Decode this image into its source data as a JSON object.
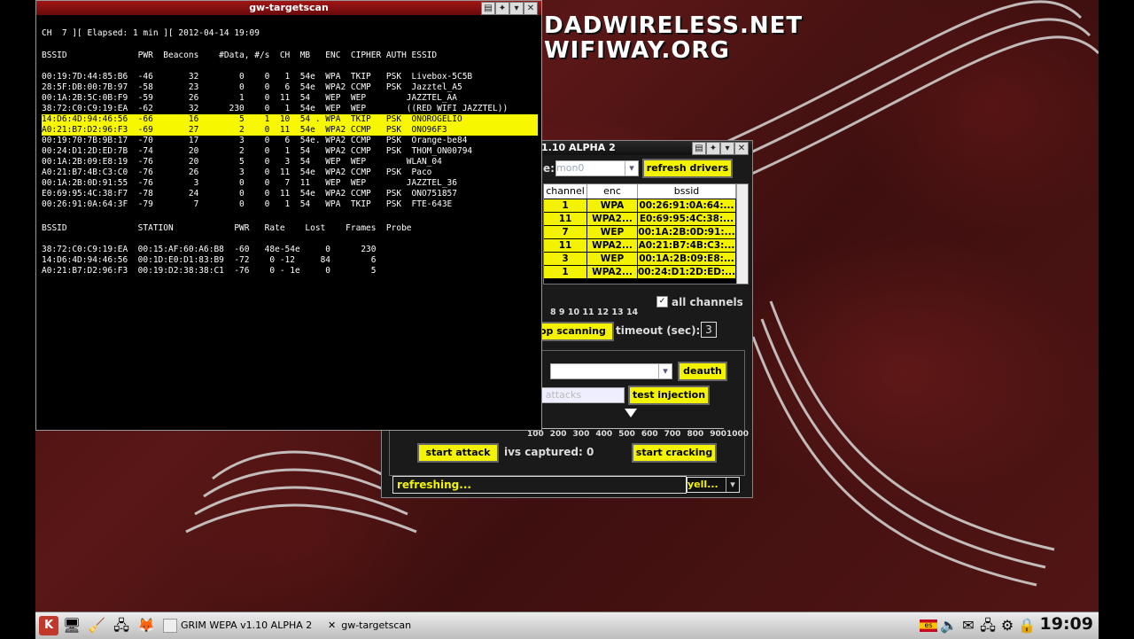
{
  "desktop": {
    "brand_line1": "DADWIRELESS.NET",
    "brand_line2": "WIFIWAY.ORG"
  },
  "terminal": {
    "title": "gw-targetscan",
    "status_line": "CH  7 ][ Elapsed: 1 min ][ 2012-04-14 19:09",
    "ap_header": "BSSID              PWR  Beacons    #Data, #/s  CH  MB   ENC  CIPHER AUTH ESSID",
    "ap_rows": [
      {
        "text": "00:19:7D:44:85:B6  -46       32        0    0   1  54e  WPA  TKIP   PSK  Livebox-5C5B",
        "hl": false
      },
      {
        "text": "28:5F:DB:00:7B:97  -58       23        0    0   6  54e  WPA2 CCMP   PSK  Jazztel_A5",
        "hl": false
      },
      {
        "text": "00:1A:2B:5C:0B:F9  -59       26        1    0  11  54   WEP  WEP        JAZZTEL_AA",
        "hl": false
      },
      {
        "text": "38:72:C0:C9:19:EA  -62       32      230    0   1  54e  WEP  WEP        ((RED WIFI JAZZTEL))",
        "hl": false
      },
      {
        "text": "14:D6:4D:94:46:56  -66       16        5    1  10  54 . WPA  TKIP   PSK  ONOROGELIO",
        "hl": true
      },
      {
        "text": "A0:21:B7:D2:96:F3  -69       27        2    0  11  54e  WPA2 CCMP   PSK  ONO96F3",
        "hl": true
      },
      {
        "text": "00:19:70:7B:9B:17  -70       17        3    0   6  54e. WPA2 CCMP   PSK  Orange-be84",
        "hl": false
      },
      {
        "text": "00:24:D1:2D:ED:7B  -74       20        2    0   1  54   WPA2 CCMP   PSK  THOM_ON00794",
        "hl": false
      },
      {
        "text": "00:1A:2B:09:E8:19  -76       20        5    0   3  54   WEP  WEP        WLAN_04",
        "hl": false
      },
      {
        "text": "A0:21:B7:4B:C3:C0  -76       26        3    0  11  54e  WPA2 CCMP   PSK  Paco",
        "hl": false
      },
      {
        "text": "00:1A:2B:0D:91:55  -76        3        0    0   7  11   WEP  WEP        JAZZTEL_36",
        "hl": false
      },
      {
        "text": "E0:69:95:4C:38:F7  -78       24        0    0  11  54e  WPA2 CCMP   PSK  ONO751857",
        "hl": false
      },
      {
        "text": "00:26:91:0A:64:3F  -79        7        0    0   1  54   WPA  TKIP   PSK  FTE-643E",
        "hl": false
      }
    ],
    "sta_header": "BSSID              STATION            PWR   Rate    Lost    Frames  Probe",
    "sta_rows": [
      "38:72:C0:C9:19:EA  00:15:AF:60:A6:B8  -60   48e-54e     0      230",
      "14:D6:4D:94:46:56  00:1D:E0:D1:83:B9  -72    0 -12     84        6",
      "A0:21:B7:D2:96:F3  00:19:D2:38:38:C1  -76    0 - 1e     0        5"
    ]
  },
  "wepa": {
    "title": "1.10 ALPHA 2",
    "iface_label": "e:",
    "iface_value": "mon0",
    "refresh_drivers": "refresh drivers",
    "table_headers": [
      "channel",
      "enc",
      "bssid"
    ],
    "table_rows": [
      {
        "ch": "1",
        "enc": "WPA",
        "bssid": "00:26:91:0A:64:..."
      },
      {
        "ch": "11",
        "enc": "WPA2...",
        "bssid": "E0:69:95:4C:38:..."
      },
      {
        "ch": "7",
        "enc": "WEP",
        "bssid": "00:1A:2B:0D:91:..."
      },
      {
        "ch": "11",
        "enc": "WPA2...",
        "bssid": "A0:21:B7:4B:C3:..."
      },
      {
        "ch": "3",
        "enc": "WEP",
        "bssid": "00:1A:2B:09:E8:..."
      },
      {
        "ch": "1",
        "enc": "WPA2...",
        "bssid": "00:24:D1:2D:ED:..."
      }
    ],
    "channel_ticks": "8  9 10 11 12 13 14",
    "all_channels": "all channels",
    "stop_scanning": "op scanning",
    "timeout_label": "timeout (sec):",
    "timeout_value": "3",
    "deauth": "deauth",
    "start_attacks": "t attacks",
    "test_injection": "test injection",
    "speed_ticks": [
      "100",
      "200",
      "300",
      "400",
      "500",
      "600",
      "700",
      "800",
      "9001000"
    ],
    "speed_value": 0.5,
    "start_attack": "start attack",
    "ivs_captured": "ivs captured: 0",
    "start_cracking": "start cracking",
    "status": "refreshing...",
    "status_color": "yell..."
  },
  "taskbar": {
    "task1": "GRIM WEPA v1.10 ALPHA 2",
    "task2": "gw-targetscan",
    "clock": "19:09"
  },
  "colors": {
    "highlight": "#f7f700",
    "titlebar": "#a01616"
  }
}
